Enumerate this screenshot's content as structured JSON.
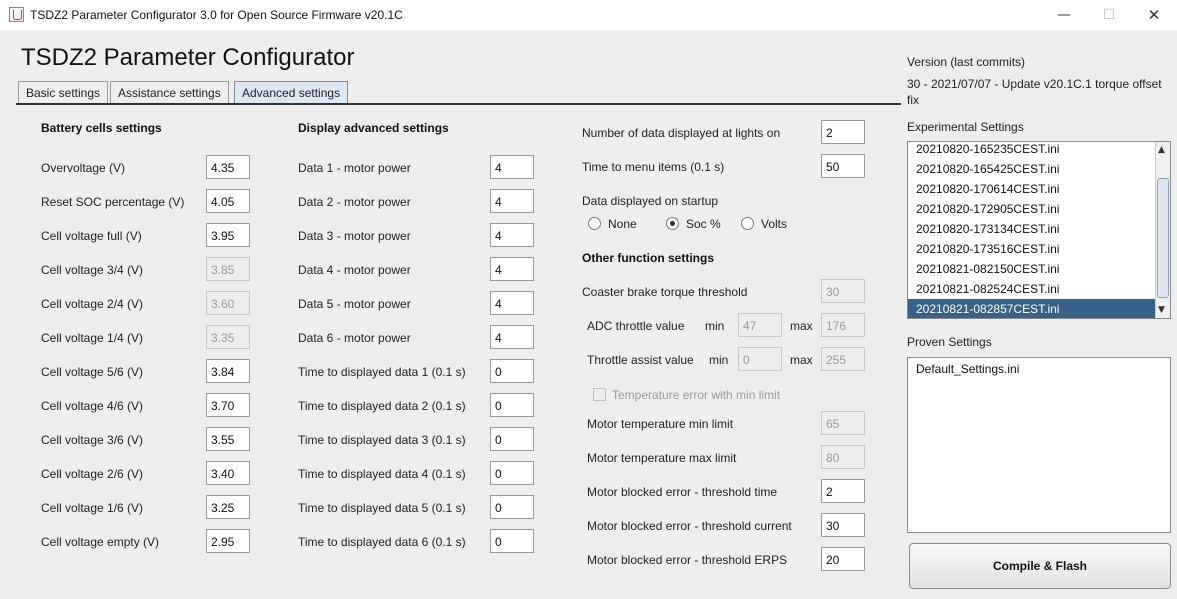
{
  "window": {
    "title": "TSDZ2 Parameter Configurator 3.0 for Open Source Firmware v20.1C",
    "minimize": "—",
    "maximize": "☐",
    "close": "✕"
  },
  "header": {
    "title": "TSDZ2 Parameter Configurator"
  },
  "tabs": [
    {
      "label": "Basic settings",
      "active": false
    },
    {
      "label": "Assistance settings",
      "active": false
    },
    {
      "label": "Advanced settings",
      "active": true
    }
  ],
  "battery": {
    "heading": "Battery cells settings",
    "rows": [
      {
        "label": "Overvoltage (V)",
        "value": "4.35",
        "enabled": true
      },
      {
        "label": "Reset SOC percentage (V)",
        "value": "4.05",
        "enabled": true
      },
      {
        "label": "Cell voltage full (V)",
        "value": "3.95",
        "enabled": true
      },
      {
        "label": "Cell voltage 3/4 (V)",
        "value": "3.85",
        "enabled": false
      },
      {
        "label": "Cell voltage 2/4 (V)",
        "value": "3.60",
        "enabled": false
      },
      {
        "label": "Cell voltage 1/4 (V)",
        "value": "3.35",
        "enabled": false
      },
      {
        "label": "Cell voltage 5/6 (V)",
        "value": "3.84",
        "enabled": true
      },
      {
        "label": "Cell voltage 4/6 (V)",
        "value": "3.70",
        "enabled": true
      },
      {
        "label": "Cell voltage 3/6 (V)",
        "value": "3.55",
        "enabled": true
      },
      {
        "label": "Cell voltage 2/6 (V)",
        "value": "3.40",
        "enabled": true
      },
      {
        "label": "Cell voltage 1/6 (V)",
        "value": "3.25",
        "enabled": true
      },
      {
        "label": "Cell voltage empty (V)",
        "value": "2.95",
        "enabled": true
      }
    ]
  },
  "display": {
    "heading": "Display advanced settings",
    "rows": [
      {
        "label": "Data 1 - motor power",
        "value": "4"
      },
      {
        "label": "Data 2 - motor power",
        "value": "4"
      },
      {
        "label": "Data 3 - motor power",
        "value": "4"
      },
      {
        "label": "Data 4 - motor power",
        "value": "4"
      },
      {
        "label": "Data 5 - motor power",
        "value": "4"
      },
      {
        "label": "Data 6 - motor power",
        "value": "4"
      },
      {
        "label": "Time to displayed data 1 (0.1 s)",
        "value": "0"
      },
      {
        "label": "Time to displayed data 2 (0.1 s)",
        "value": "0"
      },
      {
        "label": "Time to displayed data 3 (0.1 s)",
        "value": "0"
      },
      {
        "label": "Time to displayed data 4 (0.1 s)",
        "value": "0"
      },
      {
        "label": "Time to displayed data 5 (0.1 s)",
        "value": "0"
      },
      {
        "label": "Time to displayed data 6 (0.1 s)",
        "value": "0"
      }
    ]
  },
  "misc": {
    "lights_label": "Number of data displayed at lights on",
    "lights_value": "2",
    "menu_label": "Time to menu items (0.1 s)",
    "menu_value": "50",
    "startup_label": "Data displayed on startup",
    "startup_options": [
      "None",
      "Soc %",
      "Volts"
    ],
    "startup_selected": "Soc %"
  },
  "other": {
    "heading": "Other function settings",
    "coaster_label": "Coaster brake torque threshold",
    "coaster_value": "30",
    "adc_label": "ADC throttle value",
    "adc_min_label": "min",
    "adc_min": "47",
    "adc_max_label": "max",
    "adc_max": "176",
    "assist_label": "Throttle assist value",
    "assist_min_label": "min",
    "assist_min": "0",
    "assist_max_label": "max",
    "assist_max": "255",
    "temp_error_label": "Temperature error with min limit",
    "temp_min_label": "Motor temperature min limit",
    "temp_min": "65",
    "temp_max_label": "Motor temperature max limit",
    "temp_max": "80",
    "blocked_time_label": "Motor blocked error - threshold time",
    "blocked_time": "2",
    "blocked_current_label": "Motor blocked error - threshold current",
    "blocked_current": "30",
    "blocked_erps_label": "Motor blocked error - threshold ERPS",
    "blocked_erps": "20"
  },
  "side": {
    "version_label": "Version (last commits)",
    "version_line1": "30 - 2021/07/07 - Update v20.1C.1 torque offset",
    "version_line2": "fix",
    "experimental_label": "Experimental Settings",
    "experimental_items": [
      "20210820-165235CEST.ini",
      "20210820-165425CEST.ini",
      "20210820-170614CEST.ini",
      "20210820-172905CEST.ini",
      "20210820-173134CEST.ini",
      "20210820-173516CEST.ini",
      "20210821-082150CEST.ini",
      "20210821-082524CEST.ini",
      "20210821-082857CEST.ini"
    ],
    "experimental_selected_index": 8,
    "proven_label": "Proven Settings",
    "proven_items": [
      "Default_Settings.ini"
    ],
    "compile_label": "Compile & Flash",
    "scroll_up": "▲",
    "scroll_down": "▼"
  },
  "colors": {
    "selection": "#36628a",
    "active_tab": "#dde8f3",
    "background": "#eeeeee"
  }
}
